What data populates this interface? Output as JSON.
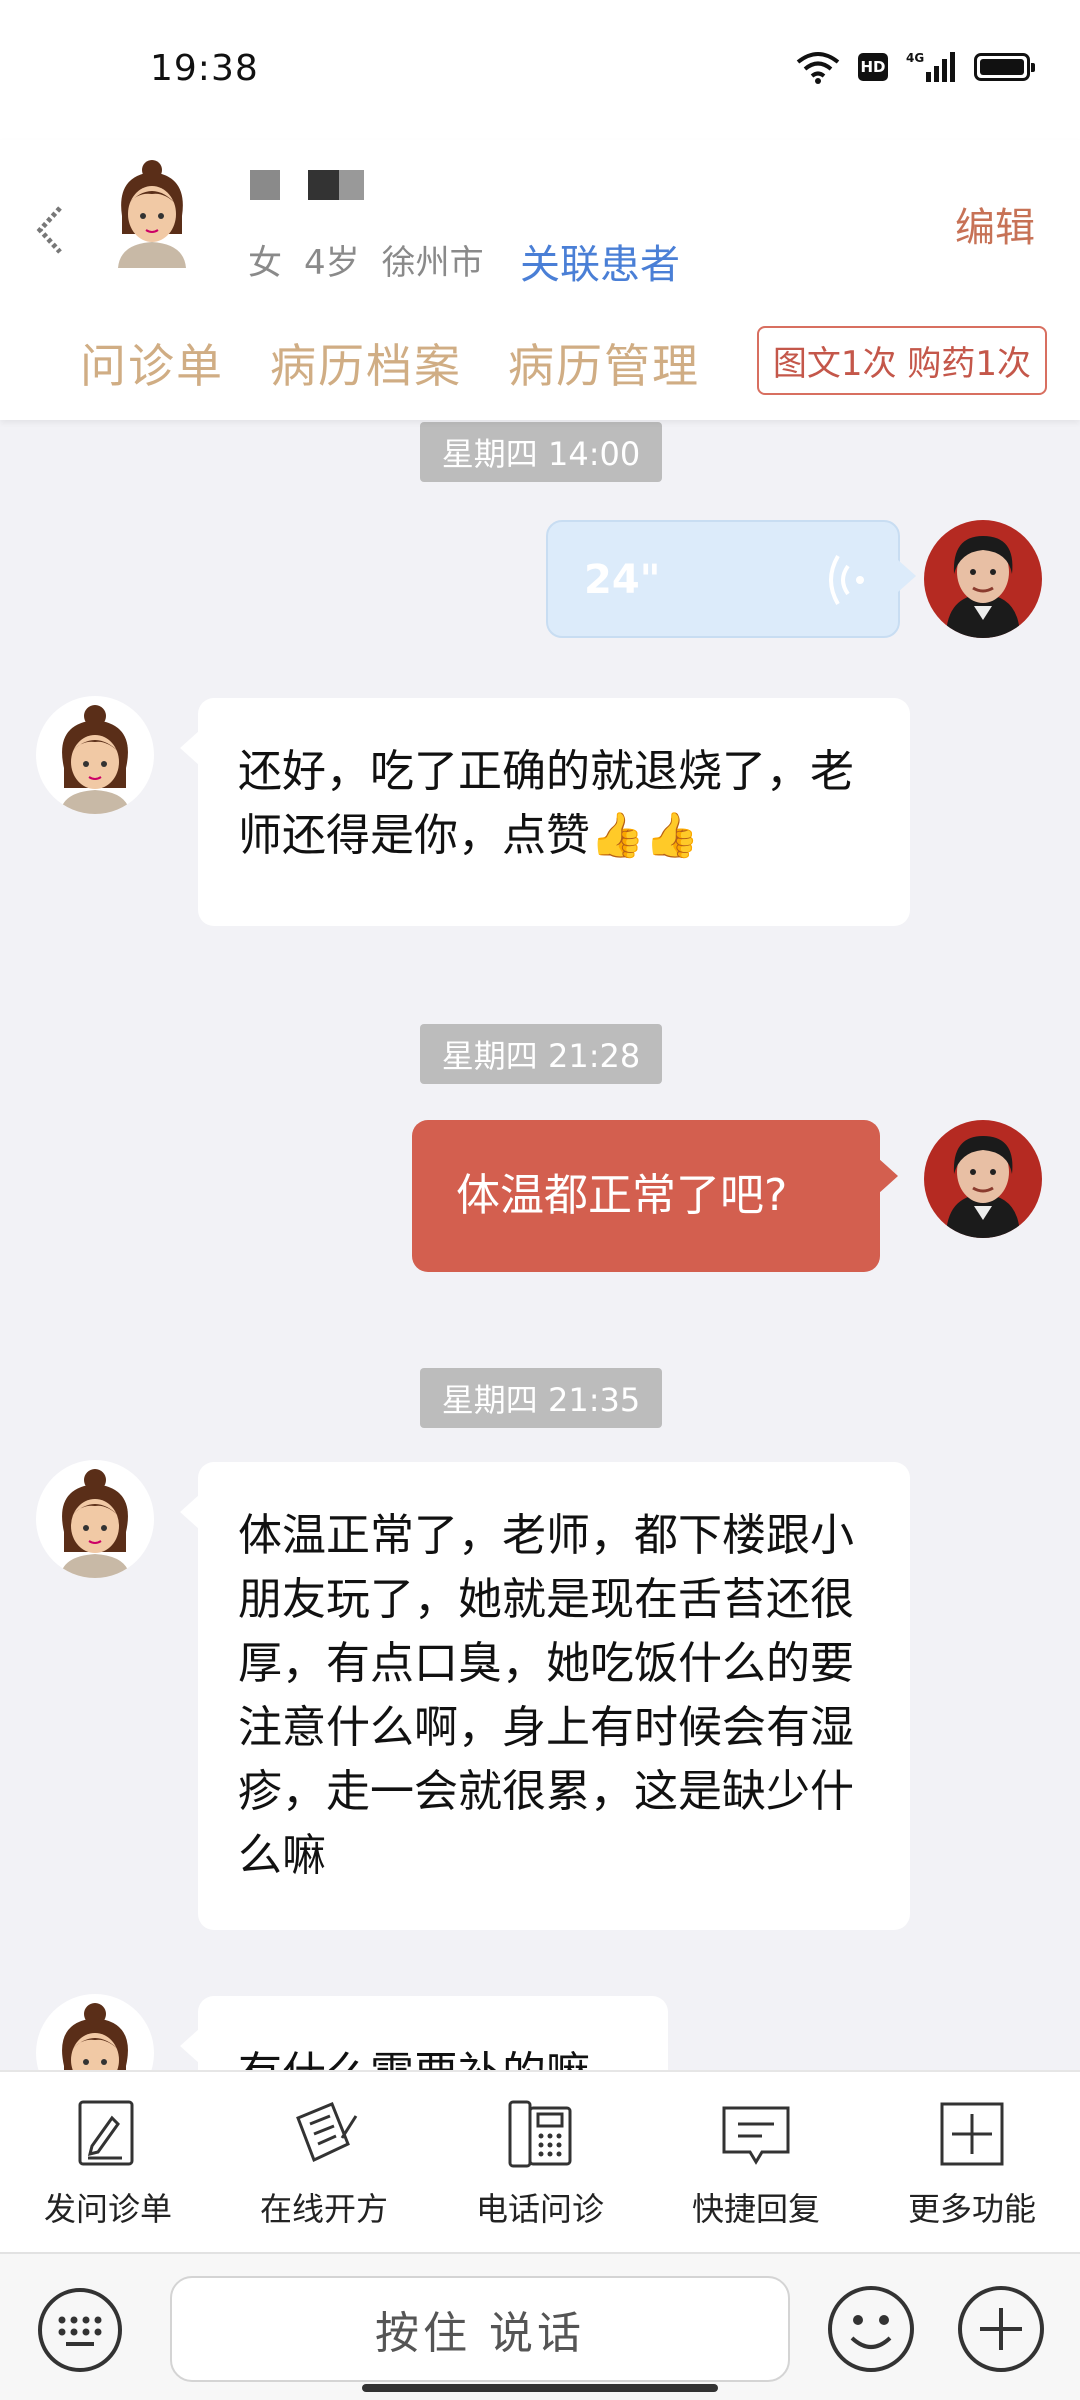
{
  "status_bar": {
    "time": "19:38",
    "hd": "HD",
    "network": "4G",
    "battery_level_percent": 100
  },
  "header": {
    "gender": "女",
    "age": "4岁",
    "city": "徐州市",
    "link_patient": "关联患者",
    "edit": "编辑",
    "tabs": [
      "问诊单",
      "病历档案",
      "病历管理"
    ],
    "service_tag": "图文1次 购药1次"
  },
  "chat": {
    "ts1": "星期四 14:00",
    "voice_duration": "24\"",
    "msg1": "还好，吃了正确的就退烧了，老师还得是你，点赞👍👍",
    "ts2": "星期四 21:28",
    "msg2": "体温都正常了吧?",
    "ts3": "星期四 21:35",
    "msg3": "体温正常了，老师，都下楼跟小朋友玩了，她就是现在舌苔还很厚，有点口臭，她吃饭什么的要注意什么啊，身上有时候会有湿疹，走一会就很累，这是缺少什么嘛",
    "msg4_partial": "有什么需要补的嘛"
  },
  "functions": [
    {
      "label": "发问诊单",
      "icon": "form-icon"
    },
    {
      "label": "在线开方",
      "icon": "prescription-icon"
    },
    {
      "label": "电话问诊",
      "icon": "phone-icon"
    },
    {
      "label": "快捷回复",
      "icon": "quick-reply-icon"
    },
    {
      "label": "更多功能",
      "icon": "more-icon"
    }
  ],
  "input": {
    "hold_to_talk": "按住 说话"
  },
  "colors": {
    "accent_red": "#d35f4f",
    "tab_gold": "#d0ad84",
    "link_blue": "#4a7fd6",
    "chat_bg": "#f2f2f6"
  }
}
